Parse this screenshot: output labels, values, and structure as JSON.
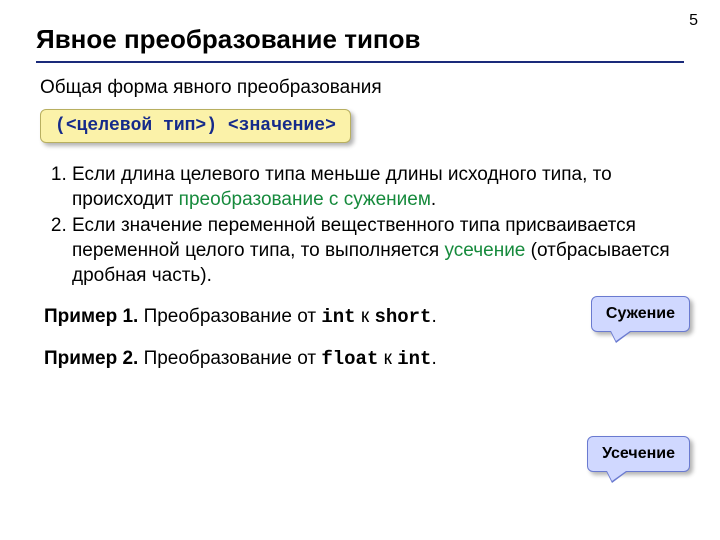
{
  "page_number": "5",
  "title": "Явное преобразование типов",
  "intro": "Общая форма явного преобразования",
  "code": {
    "lparen": "(",
    "target": "<целевой тип>",
    "rparen": ") ",
    "value": "<значение>"
  },
  "rules": [
    {
      "pre": "Если длина целевого типа меньше длины исходного типа, то происходит ",
      "hl": "преобразование с сужением",
      "post": "."
    },
    {
      "pre": "Если значение переменной вещественного типа присваивается переменной целого типа, то выполняется ",
      "hl": "усечение",
      "post": " (отбрасывается дробная часть)."
    }
  ],
  "examples": {
    "ex1": {
      "label": "Пример 1.",
      "a": " Преобразование от ",
      "t1": "int",
      "b": " к ",
      "t2": "short",
      "c": "."
    },
    "ex2": {
      "label": "Пример 2.",
      "a": " Преобразование от ",
      "t1": "float",
      "b": " к ",
      "t2": "int",
      "c": "."
    }
  },
  "callouts": {
    "narrowing": "Сужение",
    "truncation": "Усечение"
  }
}
